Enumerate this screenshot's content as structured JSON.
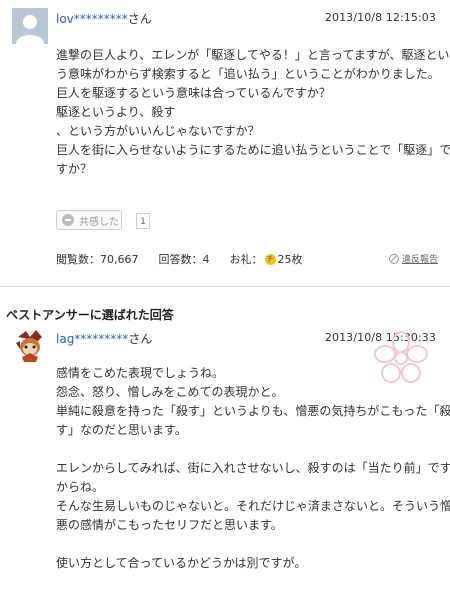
{
  "question": {
    "user_name": "lov*********",
    "user_suffix": "さん",
    "date": "2013/10/8  12:15:03",
    "lines": [
      "進撃の巨人より、エレンが「駆逐してやる！」と言ってますが、駆逐とい",
      "う意味がわからず検索すると「追い払う」ということがわかりました。",
      "巨人を駆逐するという意味は合っているんですか？",
      "駆逐というより、殺す",
      "、という方がいいんじゃないですか？",
      "巨人を街に入らせないようにするために追い払うということで「駆逐」で",
      "すか？"
    ],
    "agree_label": "共感した",
    "agree_count": "1",
    "views_label": "閲覧数：70,667",
    "answers_label": "回答数：4",
    "reward_label": "お礼：",
    "reward_coin": "チ",
    "reward_value": "25枚",
    "report_label": "違反報告"
  },
  "best_answer": {
    "heading": "ベストアンサーに選ばれた回答",
    "user_name": "lag*********",
    "user_suffix": "さん",
    "date": "2013/10/8  15:30:33",
    "lines": [
      "感情をこめた表現でしょうね。",
      "怨念、怒り、憎しみをこめての表現かと。",
      "単純に殺意を持った「殺す」というよりも、憎悪の気持ちがこもった「殺",
      "す」なのだと思います。",
      "",
      "エレンからしてみれば、街に入れさせないし、殺すのは「当たり前」です",
      "からね。",
      "そんな生易しいものじゃないと。それだけじゃ済まさないと。そういう憎",
      "悪の感情がこもったセリフだと思います。",
      "",
      "使い方として合っているかどうかは別ですが。"
    ]
  },
  "colors": {
    "username": "#2e64b5",
    "text": "#333333",
    "divider": "#dddddd",
    "coin": "#f5c21c"
  },
  "icons": [
    "default-avatar-icon",
    "agree-icon",
    "coin-icon",
    "report-icon",
    "character-avatar-icon",
    "cherry-blossom-badge-icon"
  ]
}
